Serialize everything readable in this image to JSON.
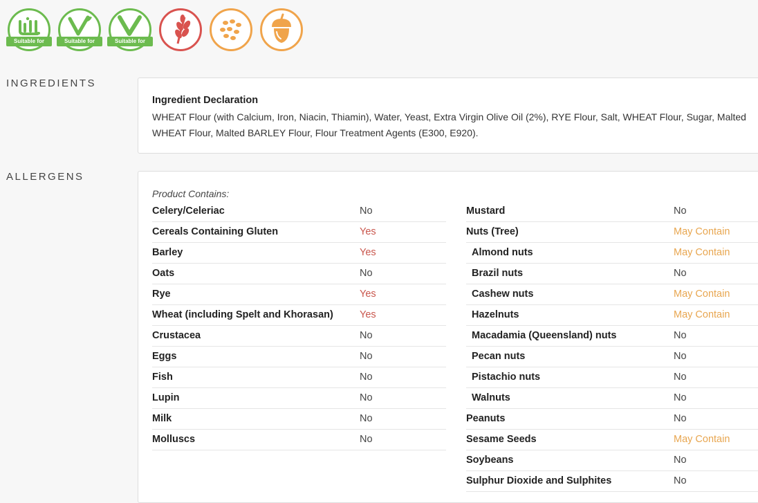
{
  "badges": [
    {
      "icon": "halal-icon",
      "ribbon": "Suitable for",
      "color": "#6cbb4f"
    },
    {
      "icon": "vegetarian-icon",
      "ribbon": "Suitable for",
      "color": "#6cbb4f"
    },
    {
      "icon": "vegan-icon",
      "ribbon": "Suitable for",
      "color": "#6cbb4f"
    },
    {
      "icon": "gluten-wheat-icon",
      "color": "#d9534f"
    },
    {
      "icon": "sesame-seeds-icon",
      "color": "#f0a44b"
    },
    {
      "icon": "tree-nut-acorn-icon",
      "color": "#f0a44b"
    }
  ],
  "ingredients": {
    "section_label": "INGREDIENTS",
    "title": "Ingredient Declaration",
    "text": "WHEAT Flour (with Calcium, Iron, Niacin, Thiamin), Water, Yeast, Extra Virgin Olive Oil (2%), RYE Flour, Salt, WHEAT Flour, Sugar, Malted WHEAT Flour, Malted BARLEY Flour, Flour Treatment Agents (E300, E920)."
  },
  "allergens": {
    "section_label": "ALLERGENS",
    "contains_label": "Product Contains:",
    "colors": {
      "yes": "#c9574d",
      "may_contain": "#e8a650"
    },
    "left": [
      {
        "name": "Celery/Celeriac",
        "value": "No",
        "status": "no"
      },
      {
        "name": "Cereals Containing Gluten",
        "value": "Yes",
        "status": "yes"
      },
      {
        "name": "Barley",
        "value": "Yes",
        "status": "yes"
      },
      {
        "name": "Oats",
        "value": "No",
        "status": "no"
      },
      {
        "name": "Rye",
        "value": "Yes",
        "status": "yes"
      },
      {
        "name": "Wheat (including Spelt and Khorasan)",
        "value": "Yes",
        "status": "yes"
      },
      {
        "name": "Crustacea",
        "value": "No",
        "status": "no"
      },
      {
        "name": "Eggs",
        "value": "No",
        "status": "no"
      },
      {
        "name": "Fish",
        "value": "No",
        "status": "no"
      },
      {
        "name": "Lupin",
        "value": "No",
        "status": "no"
      },
      {
        "name": "Milk",
        "value": "No",
        "status": "no"
      },
      {
        "name": "Molluscs",
        "value": "No",
        "status": "no"
      }
    ],
    "right": [
      {
        "name": "Mustard",
        "value": "No",
        "status": "no",
        "sub": false
      },
      {
        "name": "Nuts (Tree)",
        "value": "May Contain",
        "status": "may",
        "sub": false
      },
      {
        "name": "Almond nuts",
        "value": "May Contain",
        "status": "may",
        "sub": true
      },
      {
        "name": "Brazil nuts",
        "value": "No",
        "status": "no",
        "sub": true
      },
      {
        "name": "Cashew nuts",
        "value": "May Contain",
        "status": "may",
        "sub": true
      },
      {
        "name": "Hazelnuts",
        "value": "May Contain",
        "status": "may",
        "sub": true
      },
      {
        "name": "Macadamia (Queensland) nuts",
        "value": "No",
        "status": "no",
        "sub": true
      },
      {
        "name": "Pecan nuts",
        "value": "No",
        "status": "no",
        "sub": true
      },
      {
        "name": "Pistachio nuts",
        "value": "No",
        "status": "no",
        "sub": true
      },
      {
        "name": "Walnuts",
        "value": "No",
        "status": "no",
        "sub": true
      },
      {
        "name": "Peanuts",
        "value": "No",
        "status": "no",
        "sub": false
      },
      {
        "name": "Sesame Seeds",
        "value": "May Contain",
        "status": "may",
        "sub": false
      },
      {
        "name": "Soybeans",
        "value": "No",
        "status": "no",
        "sub": false
      },
      {
        "name": "Sulphur Dioxide and Sulphites",
        "value": "No",
        "status": "no",
        "sub": false
      }
    ]
  }
}
